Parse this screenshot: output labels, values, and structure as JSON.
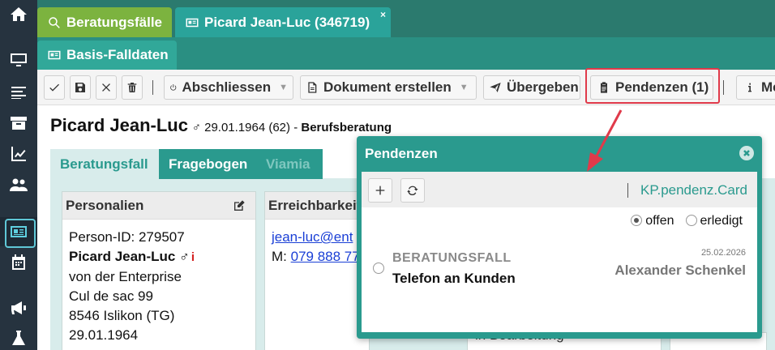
{
  "header": {
    "tab_search": "Beratungsfälle",
    "tab_person": "Picard Jean-Luc (346719)",
    "tab_close": "×",
    "subtab": "Basis-Falldaten"
  },
  "toolbar": {
    "abschliessen": "Abschliessen",
    "dokument": "Dokument erstellen",
    "uebergeben": "Übergeben",
    "pendenzen": "Pendenzen (1)",
    "more": "Me"
  },
  "person": {
    "name": "Picard Jean-Luc",
    "meta": "♂ 29.01.1964 (62) - ",
    "type": "Berufsberatung"
  },
  "tabs": {
    "t1": "Beratungsfall",
    "t2": "Fragebogen",
    "t3": "Viamia"
  },
  "personalien": {
    "title": "Personalien",
    "lines": [
      "Person-ID: 279507",
      "Picard Jean-Luc ♂",
      "von der Enterprise",
      "Cul de sac 99",
      "8546 Islikon (TG)",
      "29.01.1964"
    ],
    "info": "i"
  },
  "erreichbarkeit": {
    "title": "Erreichbarkeit",
    "email": "jean-luc@ent",
    "phone_prefix": "M: ",
    "phone": "079 888 77"
  },
  "below_text": "in Bearbeitung",
  "popup": {
    "title": "Pendenzen",
    "card_ref": "KP.pendenz.Card",
    "filter_open": "offen",
    "filter_done": "erledigt",
    "item": {
      "category": "BERATUNGSFALL",
      "title": "Telefon an Kunden",
      "date": "25.02.2026",
      "person": "Alexander Schenkel"
    }
  },
  "colors": {
    "accent": "#2a9a8e",
    "highlight": "#e03a4a",
    "green_tab": "#7cb33f"
  }
}
